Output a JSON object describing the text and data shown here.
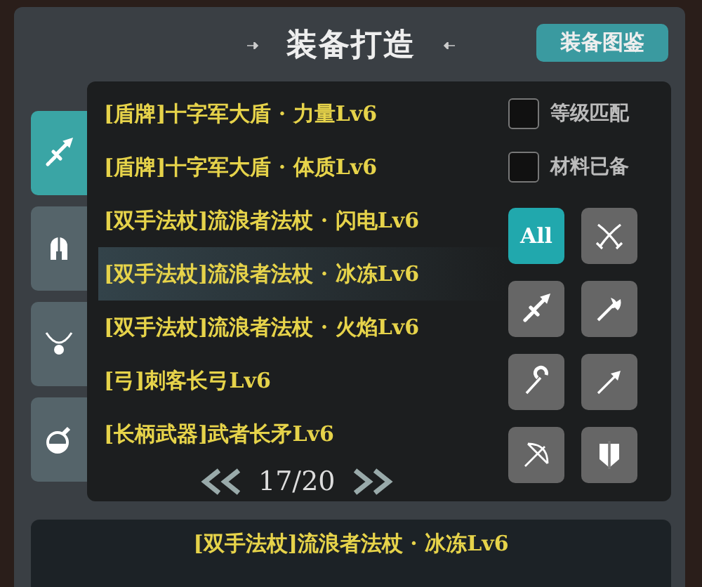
{
  "title": "装备打造",
  "atlas_button": "装备图鉴",
  "category_tabs": [
    {
      "kind": "sword",
      "selected": true
    },
    {
      "kind": "helmet",
      "selected": false
    },
    {
      "kind": "necklace",
      "selected": false
    },
    {
      "kind": "potion",
      "selected": false
    }
  ],
  "recipes": [
    {
      "name": "[盾牌]十字军大盾 · 力量Lv6",
      "selected": false
    },
    {
      "name": "[盾牌]十字军大盾 · 体质Lv6",
      "selected": false
    },
    {
      "name": "[双手法杖]流浪者法杖 · 闪电Lv6",
      "selected": false
    },
    {
      "name": "[双手法杖]流浪者法杖 · 冰冻Lv6",
      "selected": true
    },
    {
      "name": "[双手法杖]流浪者法杖 · 火焰Lv6",
      "selected": false
    },
    {
      "name": "[弓]刺客长弓Lv6",
      "selected": false
    },
    {
      "name": "[长柄武器]武者长矛Lv6",
      "selected": false
    }
  ],
  "options": [
    {
      "label": "等级匹配",
      "checked": false
    },
    {
      "label": "材料已备",
      "checked": false
    }
  ],
  "filters": [
    {
      "kind": "all",
      "label": "All",
      "selected": true
    },
    {
      "kind": "crossed-swords",
      "selected": false
    },
    {
      "kind": "sword",
      "selected": false
    },
    {
      "kind": "axe",
      "selected": false
    },
    {
      "kind": "staff",
      "selected": false
    },
    {
      "kind": "spear",
      "selected": false
    },
    {
      "kind": "bow",
      "selected": false
    },
    {
      "kind": "shield",
      "selected": false
    }
  ],
  "pager": {
    "page": "17/20"
  },
  "detail": {
    "title": "[双手法杖]流浪者法杖 · 冰冻Lv6"
  }
}
